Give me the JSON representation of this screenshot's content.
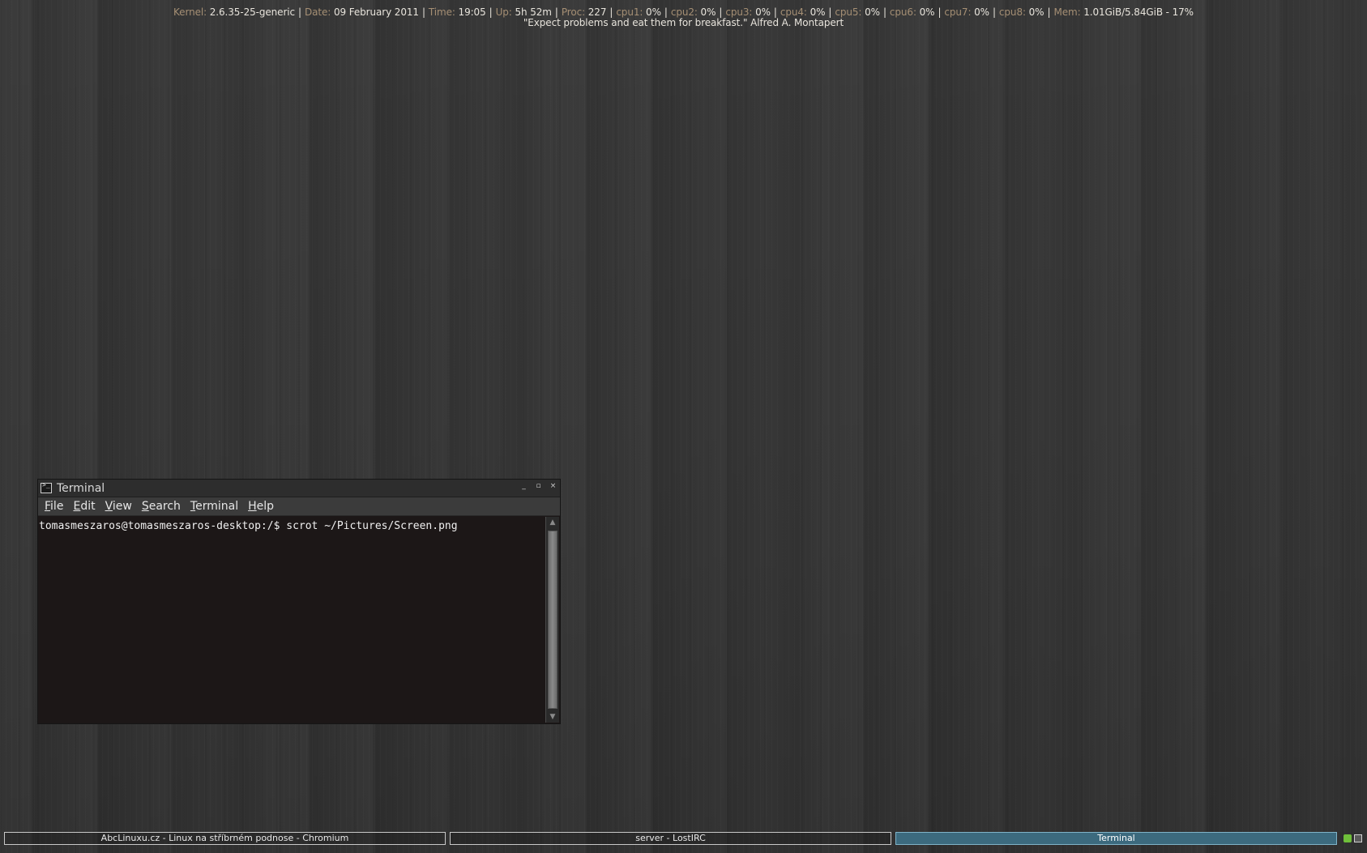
{
  "conky": {
    "kernel_label": "Kernel:",
    "kernel_value": "2.6.35-25-generic",
    "date_label": "Date:",
    "date_value": "09 February 2011",
    "time_label": "Time:",
    "time_value": "19:05",
    "up_label": "Up:",
    "up_value": "5h 52m",
    "proc_label": "Proc:",
    "proc_value": "227",
    "cpus": [
      {
        "label": "cpu1:",
        "value": "0%"
      },
      {
        "label": "cpu2:",
        "value": "0%"
      },
      {
        "label": "cpu3:",
        "value": "0%"
      },
      {
        "label": "cpu4:",
        "value": "0%"
      },
      {
        "label": "cpu5:",
        "value": "0%"
      },
      {
        "label": "cpu6:",
        "value": "0%"
      },
      {
        "label": "cpu7:",
        "value": "0%"
      },
      {
        "label": "cpu8:",
        "value": "0%"
      }
    ],
    "mem_label": "Mem:",
    "mem_value": "1.01GiB/5.84GiB - 17%",
    "quote": "\"Expect problems and eat them for breakfast.\" Alfred A. Montapert"
  },
  "terminal": {
    "title": "Terminal",
    "controls": {
      "minimize": "_",
      "maximize": "▫",
      "close": "×"
    },
    "menus": [
      {
        "u": "F",
        "rest": "ile"
      },
      {
        "u": "E",
        "rest": "dit"
      },
      {
        "u": "V",
        "rest": "iew"
      },
      {
        "u": "S",
        "rest": "earch"
      },
      {
        "u": "T",
        "rest": "erminal"
      },
      {
        "u": "H",
        "rest": "elp"
      }
    ],
    "prompt_line": "tomasmeszaros@tomasmeszaros-desktop:/$ scrot ~/Pictures/Screen.png"
  },
  "taskbar": {
    "tasks": [
      {
        "label": "AbcLinuxu.cz - Linux na stříbrném podnose - Chromium",
        "active": false
      },
      {
        "label": "server - LostIRC",
        "active": false
      },
      {
        "label": "Terminal",
        "active": true
      }
    ]
  },
  "colors": {
    "conky_label": "#a58f74",
    "conky_value": "#e8e4dc",
    "active_task": "#3c6a7e"
  },
  "icons": [
    "terminal-app-icon",
    "network-tray-icon",
    "keyboard-tray-icon"
  ]
}
